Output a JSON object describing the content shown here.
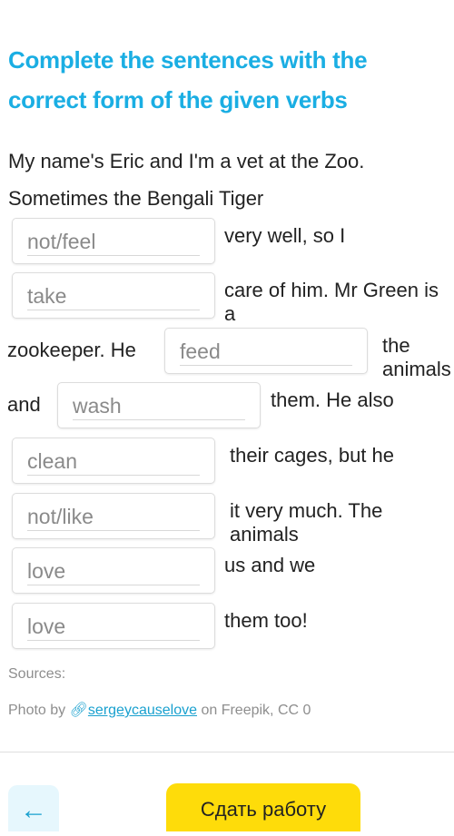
{
  "title": "Complete the sentences with the correct form of the given verbs",
  "intro": [
    "My name's Eric and I'm a vet at the Zoo.",
    "Sometimes the Bengali Tiger"
  ],
  "rows": [
    {
      "before": "",
      "hint": "not/feel",
      "value": "",
      "after": "very well, so I"
    },
    {
      "before": "",
      "hint": "take",
      "value": "",
      "after": "care of him. Mr Green is a"
    },
    {
      "before": "zookeeper. He",
      "hint": "feed",
      "value": "",
      "after": "the animals"
    },
    {
      "before": "and",
      "hint": "wash",
      "value": "",
      "after": "them. He also"
    },
    {
      "before": "",
      "hint": "clean",
      "value": "",
      "after": "their cages, but he"
    },
    {
      "before": "",
      "hint": "not/like",
      "value": "",
      "after": "it very much. The animals"
    },
    {
      "before": "",
      "hint": "love",
      "value": "",
      "after": "us and we"
    },
    {
      "before": "",
      "hint": "love",
      "value": "",
      "after": "them too!"
    }
  ],
  "sources": {
    "label": "Sources:",
    "prefix": "Photo by",
    "link_icon": "link-icon",
    "author": "sergeycauselove",
    "suffix": "on Freepik, CC 0"
  },
  "footer": {
    "back_icon": "arrow-left-icon",
    "submit_label": "Сдать работу"
  },
  "colors": {
    "accent": "#1aaee3",
    "submit": "#fedc0a"
  }
}
